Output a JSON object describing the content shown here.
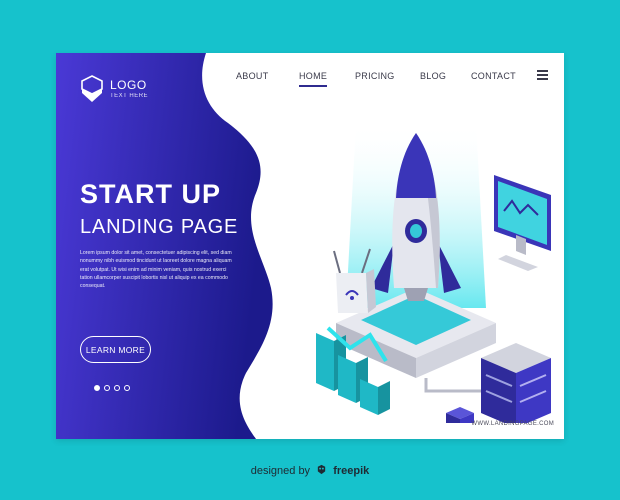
{
  "logo": {
    "title": "LOGO",
    "subtitle": "TEXT HERE",
    "icon": "hexagon-shield-icon"
  },
  "nav": {
    "items": [
      {
        "label": "ABOUT",
        "active": false
      },
      {
        "label": "HOME",
        "active": true
      },
      {
        "label": "PRICING",
        "active": false
      },
      {
        "label": "BLOG",
        "active": false
      },
      {
        "label": "CONTACT",
        "active": false
      }
    ],
    "menu_icon": "hamburger-menu-icon"
  },
  "hero": {
    "title": "START UP",
    "subtitle": "LANDING PAGE",
    "body": "Lorem ipsum dolor sit amet, consectetuer adipiscing elit, sed diam nonummy nibh euismod tincidunt ut laoreet dolore magna aliquam erat volutpat. Ut wisi enim ad minim veniam, quis nostrud exerci tation ullamcorper suscipit lobortis nisl ut aliquip ex ea commodo consequat.",
    "button_label": "LEARN MORE"
  },
  "carousel": {
    "count": 4,
    "active_index": 0
  },
  "site_url": "WWW.LANDINGPAGE.COM",
  "footer": {
    "prefix": "designed by",
    "brand": "freepik",
    "icon": "freepik-logo-icon"
  },
  "colors": {
    "background": "#16c2cc",
    "gradient_start": "#4a39d6",
    "gradient_end": "#1c1a8c",
    "text_dark": "#3a3a4a"
  },
  "illustration": [
    "rocket-icon",
    "monitor-chart-icon",
    "wifi-router-icon",
    "bar-chart-icon",
    "server-rack-icon",
    "cube-icon"
  ]
}
